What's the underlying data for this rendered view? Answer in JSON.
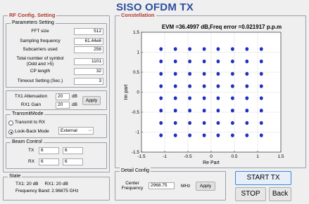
{
  "app": {
    "title": "SISO OFDM TX"
  },
  "rf_config": {
    "title": "RF Config. Setting",
    "params": {
      "title": "Parameters Setting",
      "fields": [
        {
          "label": "FFT size",
          "value": "512"
        },
        {
          "label": "Sampling frequency",
          "value": "61.44e6"
        },
        {
          "label": "Subcarriers used",
          "value": "256"
        },
        {
          "label_line1": "Total number of symbol",
          "label_line2": "(Odd and >5)",
          "value": "1101"
        },
        {
          "label": "CP length",
          "value": "32"
        },
        {
          "label": "Timeout Setting (Sec.)",
          "value": "3"
        }
      ]
    },
    "gain": {
      "tx1_label": "TX1 Attenuation",
      "tx1_value": "20",
      "tx1_unit": "dB",
      "rx1_label": "RX1 Gain",
      "rx1_value": "20",
      "rx1_unit": "dB",
      "apply_label": "Apply"
    },
    "transmit_mode": {
      "title": "TransmitMode",
      "option1": "Transmit to RX",
      "option2": "Look-Back Mode",
      "selected": "Look-Back Mode",
      "loopback_value": "External"
    },
    "beam": {
      "title": "Beam Control",
      "tx_label": "TX",
      "tx_values": [
        "6",
        "6"
      ],
      "rx_label": "RX",
      "rx_values": [
        "6",
        "6"
      ]
    }
  },
  "state": {
    "title": "State",
    "line1": "TX1: 20 dB     RX1: 20 dB",
    "line2": "Frequency Band: 2.96875 GHz"
  },
  "constellation": {
    "title": "Constellation",
    "plot_title": "EVM =36.4997 dB,Freq error =0.021917 p.p.m"
  },
  "detail": {
    "title": "Detail Config",
    "center_line1": "Center",
    "center_line2": "Frequency",
    "value": "2968.75",
    "unit": "MHz",
    "apply_label": "Apply"
  },
  "buttons": {
    "start": "START TX",
    "stop": "STOP",
    "back": "Back"
  },
  "chart_data": {
    "type": "scatter",
    "title": "EVM =36.4997 dB,Freq error =0.021917 p.p.m",
    "xlabel": "Re Part",
    "ylabel": "Im part",
    "xlim": [
      -1.5,
      1.5
    ],
    "ylim": [
      -1.5,
      1.5
    ],
    "xticks": [
      -1.5,
      -1,
      -0.5,
      0,
      0.5,
      1,
      1.5
    ],
    "yticks": [
      -1.5,
      -1,
      -0.5,
      0,
      0.5,
      1,
      1.5
    ],
    "xtick_labels": [
      "-1.5",
      "-1",
      "-0.5",
      "0",
      "0.5",
      "1",
      "1.5"
    ],
    "ytick_labels": [
      "-1.5",
      "-1",
      "-0.5",
      "0",
      "0.5",
      "1",
      "1.5"
    ],
    "grid": true,
    "marker_color": "#1f2fbf",
    "series": [
      {
        "values_x": [
          -1.08,
          -0.77,
          -0.46,
          -0.15,
          0.15,
          0.46,
          0.77,
          1.08
        ],
        "values_y": [
          -1.08,
          -0.77,
          -0.46,
          -0.15,
          0.15,
          0.46,
          0.77,
          1.08
        ]
      }
    ]
  }
}
